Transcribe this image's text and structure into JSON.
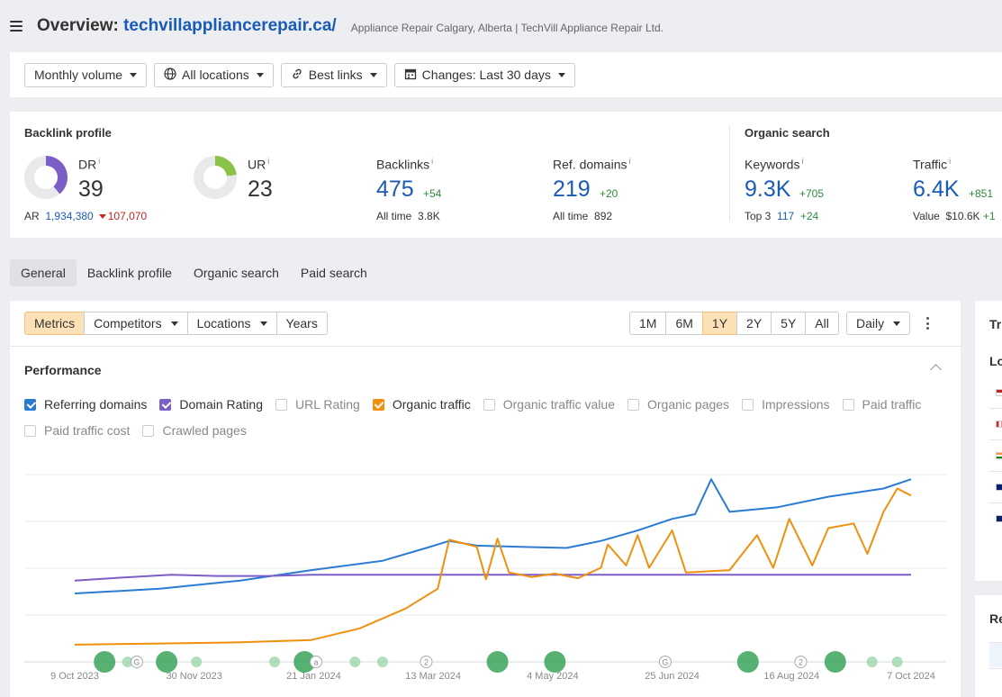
{
  "header": {
    "title_prefix": "Overview: ",
    "domain": "techvillappliancerepair.ca/",
    "subtitle": "Appliance Repair Calgary, Alberta | TechVill Appliance Repair Ltd."
  },
  "filters": [
    {
      "label": "Monthly volume",
      "icon": "none"
    },
    {
      "label": "All locations",
      "icon": "globe-icon"
    },
    {
      "label": "Best links",
      "icon": "link-icon"
    },
    {
      "label": "Changes: Last 30 days",
      "icon": "calendar-icon"
    }
  ],
  "backlink_profile": {
    "title": "Backlink profile",
    "dr": {
      "label": "DR",
      "info": "i",
      "value": "39",
      "fill": 0.39,
      "color": "#7b5fc7"
    },
    "ar": {
      "label": "AR",
      "value": "1,934,380",
      "delta": "107,070"
    },
    "ur": {
      "label": "UR",
      "info": "i",
      "value": "23",
      "fill": 0.23,
      "color": "#8bc34a"
    },
    "backlinks": {
      "label": "Backlinks",
      "info": "i",
      "value": "475",
      "delta": "+54",
      "sub_label": "All time",
      "sub_value": "3.8K"
    },
    "ref_domains": {
      "label": "Ref. domains",
      "info": "i",
      "value": "219",
      "delta": "+20",
      "sub_label": "All time",
      "sub_value": "892"
    }
  },
  "organic_search": {
    "title": "Organic search",
    "keywords": {
      "label": "Keywords",
      "info": "i",
      "value": "9.3K",
      "delta": "+705",
      "sub_label": "Top 3",
      "sub_value": "117",
      "sub_delta": "+24"
    },
    "traffic": {
      "label": "Traffic",
      "info": "i",
      "value": "6.4K",
      "delta": "+851",
      "sub_label": "Value",
      "sub_value": "$10.6K",
      "sub_delta": "+1"
    }
  },
  "tabs": [
    "General",
    "Backlink profile",
    "Organic search",
    "Paid search"
  ],
  "toolbar": {
    "metrics": "Metrics",
    "competitors": "Competitors",
    "locations": "Locations",
    "years": "Years",
    "ranges": [
      "1M",
      "6M",
      "1Y",
      "2Y",
      "5Y",
      "All"
    ],
    "selected_range": "1Y",
    "interval": "Daily"
  },
  "performance": {
    "title": "Performance",
    "checkboxes_row1": [
      {
        "label": "Referring domains",
        "checked": true,
        "color": "#2b7bd3"
      },
      {
        "label": "Domain Rating",
        "checked": true,
        "color": "#7b5fc7"
      },
      {
        "label": "URL Rating",
        "checked": false,
        "color": ""
      },
      {
        "label": "Organic traffic",
        "checked": true,
        "color": "#f0900f"
      },
      {
        "label": "Organic traffic value",
        "checked": false,
        "color": ""
      },
      {
        "label": "Organic pages",
        "checked": false,
        "color": ""
      },
      {
        "label": "Impressions",
        "checked": false,
        "color": ""
      },
      {
        "label": "Paid traffic",
        "checked": false,
        "color": ""
      }
    ],
    "checkboxes_row2": [
      {
        "label": "Paid traffic cost",
        "checked": false,
        "color": ""
      },
      {
        "label": "Crawled pages",
        "checked": false,
        "color": ""
      }
    ]
  },
  "chart_data": {
    "type": "line",
    "x_tick_labels": [
      "9 Oct 2023",
      "30 Nov 2023",
      "21 Jan 2024",
      "13 Mar 2024",
      "4 May 2024",
      "25 Jun 2024",
      "16 Aug 2024",
      "7 Oct 2024"
    ],
    "x_range": [
      "2023-10-09",
      "2024-10-09"
    ],
    "grid": "horizontal",
    "series": [
      {
        "name": "Referring domains",
        "color": "#2b7bd3",
        "points": [
          [
            "2023-10-09",
            58
          ],
          [
            "2023-11-15",
            62
          ],
          [
            "2023-12-20",
            69
          ],
          [
            "2024-01-20",
            78
          ],
          [
            "2024-02-20",
            86
          ],
          [
            "2024-03-10",
            97
          ],
          [
            "2024-03-20",
            103
          ],
          [
            "2024-04-01",
            99
          ],
          [
            "2024-04-20",
            98
          ],
          [
            "2024-05-10",
            97
          ],
          [
            "2024-05-25",
            103
          ],
          [
            "2024-06-10",
            112
          ],
          [
            "2024-06-25",
            122
          ],
          [
            "2024-07-05",
            126
          ],
          [
            "2024-07-12",
            156
          ],
          [
            "2024-07-20",
            128
          ],
          [
            "2024-08-10",
            132
          ],
          [
            "2024-09-01",
            141
          ],
          [
            "2024-09-25",
            148
          ],
          [
            "2024-10-07",
            156
          ]
        ]
      },
      {
        "name": "Domain Rating",
        "color": "#7b5fc7",
        "points": [
          [
            "2023-10-09",
            69
          ],
          [
            "2023-10-25",
            71
          ],
          [
            "2023-11-20",
            74
          ],
          [
            "2023-12-10",
            73
          ],
          [
            "2024-01-01",
            73
          ],
          [
            "2024-01-20",
            74
          ],
          [
            "2024-03-15",
            74
          ],
          [
            "2024-05-01",
            74
          ],
          [
            "2024-07-01",
            74
          ],
          [
            "2024-08-01",
            74
          ],
          [
            "2024-09-01",
            74
          ],
          [
            "2024-10-07",
            74
          ]
        ]
      },
      {
        "name": "Organic traffic",
        "color": "#f0900f",
        "points": [
          [
            "2023-10-09",
            14
          ],
          [
            "2023-11-15",
            15
          ],
          [
            "2023-12-20",
            16
          ],
          [
            "2024-01-20",
            18
          ],
          [
            "2024-02-10",
            28
          ],
          [
            "2024-03-01",
            45
          ],
          [
            "2024-03-15",
            62
          ],
          [
            "2024-03-20",
            104
          ],
          [
            "2024-04-01",
            98
          ],
          [
            "2024-04-05",
            70
          ],
          [
            "2024-04-10",
            105
          ],
          [
            "2024-04-15",
            76
          ],
          [
            "2024-04-25",
            72
          ],
          [
            "2024-05-05",
            75
          ],
          [
            "2024-05-15",
            71
          ],
          [
            "2024-05-25",
            80
          ],
          [
            "2024-05-28",
            100
          ],
          [
            "2024-06-05",
            82
          ],
          [
            "2024-06-10",
            108
          ],
          [
            "2024-06-15",
            80
          ],
          [
            "2024-06-25",
            112
          ],
          [
            "2024-07-01",
            76
          ],
          [
            "2024-07-20",
            78
          ],
          [
            "2024-08-01",
            108
          ],
          [
            "2024-08-08",
            80
          ],
          [
            "2024-08-15",
            122
          ],
          [
            "2024-08-25",
            82
          ],
          [
            "2024-09-01",
            114
          ],
          [
            "2024-09-12",
            118
          ],
          [
            "2024-09-18",
            92
          ],
          [
            "2024-09-25",
            128
          ],
          [
            "2024-10-01",
            148
          ],
          [
            "2024-10-07",
            142
          ]
        ]
      }
    ],
    "event_markers": [
      {
        "x": "2023-10-22",
        "size": "large"
      },
      {
        "x": "2023-11-01",
        "size": "small"
      },
      {
        "x": "2023-11-18",
        "size": "large"
      },
      {
        "x": "2023-12-01",
        "size": "small"
      },
      {
        "x": "2024-01-04",
        "size": "small"
      },
      {
        "x": "2024-01-17",
        "size": "large"
      },
      {
        "x": "2024-02-08",
        "size": "small"
      },
      {
        "x": "2024-02-20",
        "size": "small"
      },
      {
        "x": "2024-04-10",
        "size": "large"
      },
      {
        "x": "2024-05-05",
        "size": "large"
      },
      {
        "x": "2024-07-28",
        "size": "large"
      },
      {
        "x": "2024-09-04",
        "size": "large"
      },
      {
        "x": "2024-09-20",
        "size": "small"
      },
      {
        "x": "2024-10-01",
        "size": "small"
      }
    ],
    "annotation_markers": [
      {
        "x": "2023-11-05",
        "label": "G"
      },
      {
        "x": "2024-01-22",
        "label": "a"
      },
      {
        "x": "2024-03-10",
        "label": "2"
      },
      {
        "x": "2024-06-22",
        "label": "G"
      },
      {
        "x": "2024-08-20",
        "label": "2"
      }
    ]
  },
  "right_panel": {
    "title_partial": "Tr",
    "sub_partial": "Lo",
    "bottom_partial": "Re"
  }
}
